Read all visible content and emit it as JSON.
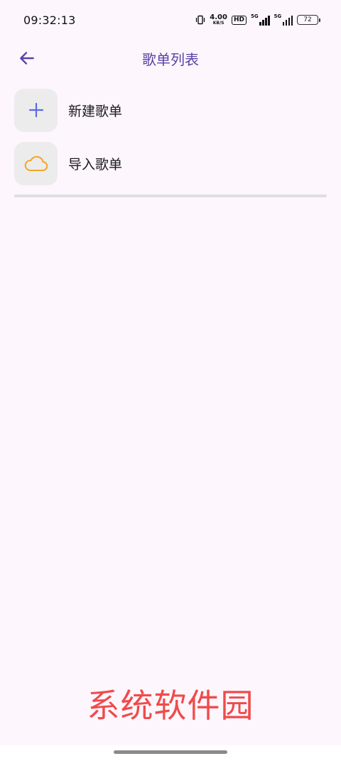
{
  "status_bar": {
    "time": "09:32:13",
    "net_speed_value": "4.00",
    "net_speed_unit": "KB/S",
    "hd_badge": "HD",
    "sim1_label": "5G",
    "sim2_label": "5G",
    "battery_level": "72",
    "icons": [
      "vibrate-icon",
      "signal-icon",
      "signal-icon",
      "battery-icon"
    ]
  },
  "app_bar": {
    "back_icon": "arrow-left-icon",
    "title": "歌单列表"
  },
  "list": {
    "items": [
      {
        "label": "新建歌单",
        "icon": "plus-icon",
        "icon_color": "#5b6be0"
      },
      {
        "label": "导入歌单",
        "icon": "cloud-icon",
        "icon_color": "#f5a623"
      }
    ]
  },
  "watermark": "系统软件园",
  "colors": {
    "background": "#fdf6fd",
    "accent": "#5a42a6",
    "icon_box": "#ececec",
    "divider": "#dedede",
    "watermark": "#f04b4b"
  }
}
